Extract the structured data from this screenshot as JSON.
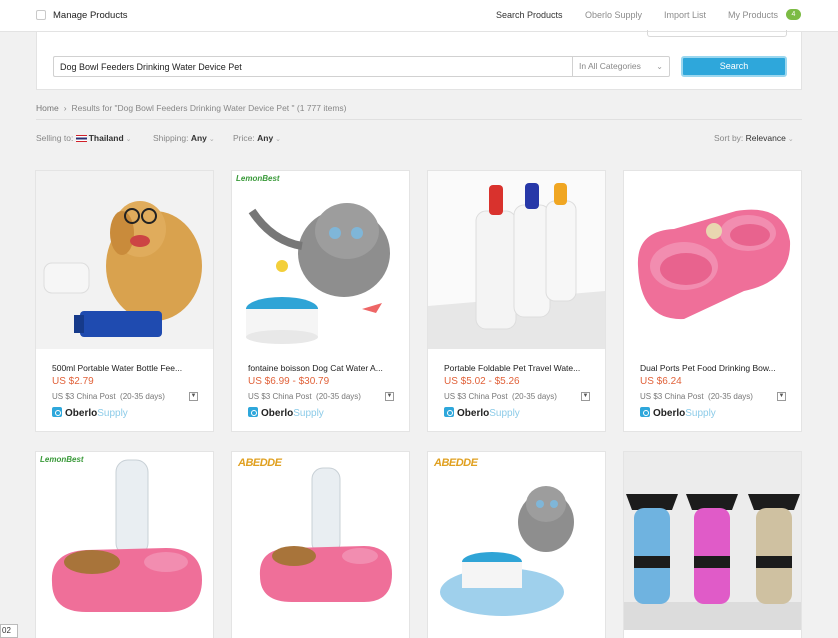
{
  "topbar": {
    "title": "Manage Products",
    "nav": [
      "Search Products",
      "Oberlo Supply",
      "Import List",
      "My Products"
    ],
    "my_products_count": "4"
  },
  "search": {
    "query": "Dog Bowl Feeders Drinking Water Device Pet",
    "category": "In All Categories",
    "button": "Search"
  },
  "breadcrumb": {
    "home": "Home",
    "results": "Results for \"Dog Bowl Feeders Drinking Water Device Pet \" (1 777 items)"
  },
  "filters": {
    "selling_label": "Selling to:",
    "selling_value": "Thailand",
    "shipping_label": "Shipping:",
    "shipping_value": "Any",
    "price_label": "Price:",
    "price_value": "Any",
    "sort_label": "Sort by:",
    "sort_value": "Relevance"
  },
  "supplier": {
    "part_a": "Oberlo",
    "part_b": "Supply"
  },
  "products": [
    {
      "title": "500ml Portable Water Bottle Fee...",
      "price": "US $2.79",
      "shipping": "US $3 China Post",
      "days": "(20-35 days)",
      "image": "dog-water-bottle"
    },
    {
      "title": "fontaine boisson Dog Cat Water A...",
      "price": "US $6.99 - $30.79",
      "shipping": "US $3 China Post",
      "days": "(20-35 days)",
      "image": "cat-water-fountain",
      "brand": "LemonBest"
    },
    {
      "title": "Portable Foldable Pet Travel Wate...",
      "price": "US $5.02 - $5.26",
      "shipping": "US $3 China Post",
      "days": "(20-35 days)",
      "image": "travel-water-bottles"
    },
    {
      "title": "Dual Ports Pet Food Drinking Bow...",
      "price": "US $6.24",
      "shipping": "US $3 China Post",
      "days": "(20-35 days)",
      "image": "pink-double-bowl"
    },
    {
      "image": "pink-bowl-bottle",
      "brand": "LemonBest"
    },
    {
      "image": "pink-bowl-bottle-2",
      "brand": "ABEDDE"
    },
    {
      "image": "cat-fountain-mat",
      "brand": "ABEDDE"
    },
    {
      "image": "dog-bottles-colors"
    }
  ],
  "page_number": "02"
}
